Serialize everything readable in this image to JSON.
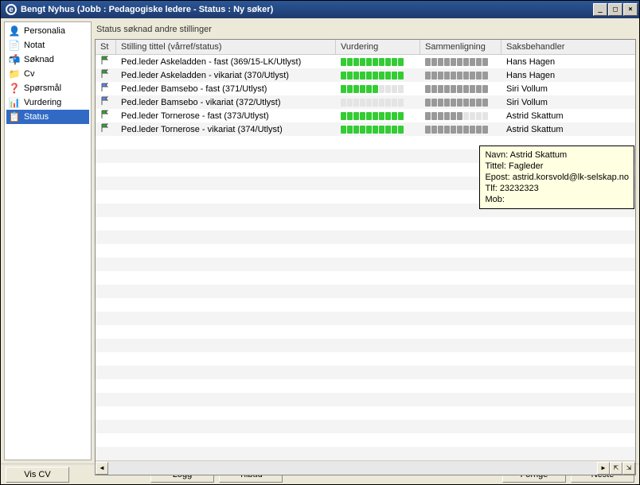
{
  "window": {
    "title": "Bengt Nyhus (Jobb : Pedagogiske ledere - Status : Ny søker)"
  },
  "sidebar": {
    "items": [
      {
        "label": "Personalia",
        "icon": "👤"
      },
      {
        "label": "Notat",
        "icon": "📄"
      },
      {
        "label": "Søknad",
        "icon": "📬"
      },
      {
        "label": "Cv",
        "icon": "📁"
      },
      {
        "label": "Spørsmål",
        "icon": "❓"
      },
      {
        "label": "Vurdering",
        "icon": "📊"
      },
      {
        "label": "Status",
        "icon": "📋"
      }
    ],
    "selected": 6
  },
  "section_title": "Status søknad andre stillinger",
  "columns": {
    "st": "St",
    "title": "Stilling tittel (vårref/status)",
    "vurd": "Vurdering",
    "samm": "Sammenligning",
    "saks": "Saksbehandler"
  },
  "rows": [
    {
      "flag": "green",
      "title": "Ped.leder Askeladden - fast (369/15-LK/Utlyst)",
      "vurd": 10,
      "vurd_max": 10,
      "samm": 10,
      "saks": "Hans Hagen"
    },
    {
      "flag": "green",
      "title": "Ped.leder Askeladden - vikariat (370/Utlyst)",
      "vurd": 10,
      "vurd_max": 10,
      "samm": 10,
      "saks": "Hans Hagen"
    },
    {
      "flag": "blue",
      "title": "Ped.leder Bamsebo - fast (371/Utlyst)",
      "vurd": 6,
      "vurd_max": 10,
      "samm": 10,
      "saks": "Siri Vollum"
    },
    {
      "flag": "blue",
      "title": "Ped.leder Bamsebo - vikariat (372/Utlyst)",
      "vurd": 0,
      "vurd_max": 10,
      "samm": 10,
      "saks": "Siri Vollum"
    },
    {
      "flag": "green",
      "title": "Ped.leder Tornerose - fast (373/Utlyst)",
      "vurd": 10,
      "vurd_max": 10,
      "samm": 6,
      "saks": "Astrid Skattum"
    },
    {
      "flag": "green",
      "title": "Ped.leder Tornerose - vikariat (374/Utlyst)",
      "vurd": 10,
      "vurd_max": 10,
      "samm": 10,
      "saks": "Astrid Skattum"
    }
  ],
  "tooltip": {
    "navn_label": "Navn:",
    "navn": "Astrid Skattum",
    "tittel_label": "Tittel:",
    "tittel": "Fagleder",
    "epost_label": "Epost:",
    "epost": "astrid.korsvold@lk-selskap.no",
    "tlf_label": "Tlf:",
    "tlf": "23232323",
    "mob_label": "Mob:",
    "mob": ""
  },
  "buttons": {
    "vis_cv": "Vis CV",
    "logg": "Logg",
    "tilbud": "Tilbud",
    "forrige": "Forrige",
    "neste": "Neste"
  }
}
